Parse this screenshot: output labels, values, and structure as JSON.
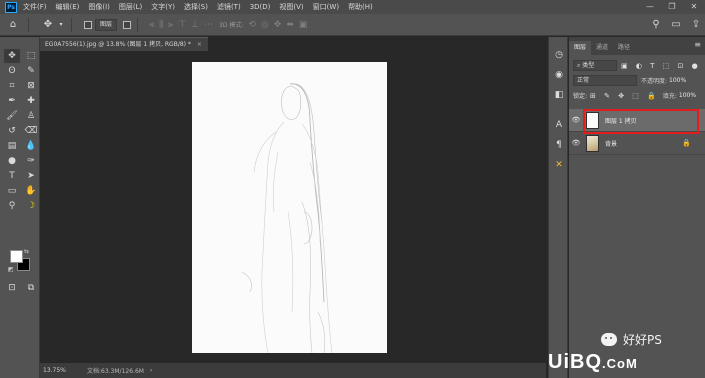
{
  "app": {
    "logo_text": "Ps"
  },
  "menu": [
    "文件(F)",
    "编辑(E)",
    "图像(I)",
    "图层(L)",
    "文字(Y)",
    "选择(S)",
    "滤镜(T)",
    "3D(D)",
    "视图(V)",
    "窗口(W)",
    "帮助(H)"
  ],
  "window_controls": [
    "—",
    "❐",
    "✕"
  ],
  "options_bar": {
    "auto_select_label": "图层",
    "mode_label": "3D 模式:"
  },
  "toolbar": {
    "tools": [
      {
        "name": "move-tool",
        "glyph": "✥",
        "active": true
      },
      {
        "name": "marquee-tool",
        "glyph": "⬚"
      },
      {
        "name": "lasso-tool",
        "glyph": "ʘ"
      },
      {
        "name": "quick-select-tool",
        "glyph": "✎"
      },
      {
        "name": "crop-tool",
        "glyph": "⌗"
      },
      {
        "name": "frame-tool",
        "glyph": "⊠"
      },
      {
        "name": "eyedropper-tool",
        "glyph": "✒"
      },
      {
        "name": "healing-brush-tool",
        "glyph": "✚"
      },
      {
        "name": "brush-tool",
        "glyph": "🖌"
      },
      {
        "name": "stamp-tool",
        "glyph": "♙"
      },
      {
        "name": "history-brush-tool",
        "glyph": "↺"
      },
      {
        "name": "eraser-tool",
        "glyph": "⌫"
      },
      {
        "name": "gradient-tool",
        "glyph": "▤"
      },
      {
        "name": "blur-tool",
        "glyph": "💧"
      },
      {
        "name": "dodge-tool",
        "glyph": "●"
      },
      {
        "name": "pen-tool",
        "glyph": "✑"
      },
      {
        "name": "type-tool",
        "glyph": "T"
      },
      {
        "name": "path-select-tool",
        "glyph": "➤"
      },
      {
        "name": "rectangle-tool",
        "glyph": "▭"
      },
      {
        "name": "hand-tool",
        "glyph": "✋"
      },
      {
        "name": "zoom-tool",
        "glyph": "⚲"
      },
      {
        "name": "banana-tool",
        "glyph": "☽",
        "banana": true
      }
    ],
    "extra": [
      {
        "name": "edit-mode-icon",
        "glyph": "⊡"
      },
      {
        "name": "screen-mode-icon",
        "glyph": "⧉"
      }
    ]
  },
  "document": {
    "tab_title": "EG0A7556(1).jpg @ 13.8% (图层 1 拷贝, RGB/8) *",
    "close_glyph": "×"
  },
  "status": {
    "zoom": "13.75%",
    "doc_size": "文档:63.3M/126.6M",
    "arrow": "›"
  },
  "icon_strip": [
    {
      "name": "history-icon",
      "glyph": "◷"
    },
    {
      "name": "properties-icon",
      "glyph": "◉"
    },
    {
      "name": "adjustments-icon",
      "glyph": "◧"
    },
    {
      "name": "character-icon",
      "glyph": "A"
    },
    {
      "name": "paragraph-icon",
      "glyph": "¶"
    },
    {
      "name": "tools-preset-icon",
      "glyph": "✕",
      "accent": true
    }
  ],
  "layers_panel": {
    "tabs": [
      "图层",
      "通道",
      "路径"
    ],
    "menu_glyph": "≡",
    "filter_label": "⌕ 类型",
    "filter_icons": "▣ ◐ T ⬚ ⊡ ●",
    "blend_mode": "正常",
    "opacity_label": "不透明度:",
    "opacity_value": "100%",
    "lock_label": "锁定:",
    "lock_icons": "⊞ ✎ ✥ ⬚ 🔒",
    "fill_label": "填充:",
    "fill_value": "100%",
    "layers": [
      {
        "name": "图层 1 拷贝",
        "visible": true,
        "selected": true,
        "thumb": "white"
      },
      {
        "name": "背景",
        "visible": true,
        "selected": false,
        "thumb": "photo",
        "locked": true
      }
    ],
    "eye_glyph": "👁",
    "lock_glyph": "🔒"
  },
  "watermark": {
    "wechat_text": "好好PS",
    "site": "UiBQ",
    "domain": ".CoM"
  },
  "colors": {
    "accent_highlight": "#e21d1d",
    "foreground": "#ffffff",
    "background": "#000000"
  }
}
